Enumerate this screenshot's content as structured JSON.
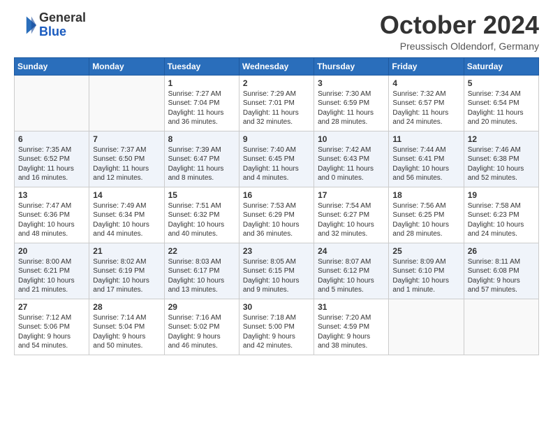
{
  "header": {
    "logo": {
      "line1": "General",
      "line2": "Blue"
    },
    "title": "October 2024",
    "subtitle": "Preussisch Oldendorf, Germany"
  },
  "days_of_week": [
    "Sunday",
    "Monday",
    "Tuesday",
    "Wednesday",
    "Thursday",
    "Friday",
    "Saturday"
  ],
  "weeks": [
    [
      {
        "day": "",
        "info": ""
      },
      {
        "day": "",
        "info": ""
      },
      {
        "day": "1",
        "info": "Sunrise: 7:27 AM\nSunset: 7:04 PM\nDaylight: 11 hours\nand 36 minutes."
      },
      {
        "day": "2",
        "info": "Sunrise: 7:29 AM\nSunset: 7:01 PM\nDaylight: 11 hours\nand 32 minutes."
      },
      {
        "day": "3",
        "info": "Sunrise: 7:30 AM\nSunset: 6:59 PM\nDaylight: 11 hours\nand 28 minutes."
      },
      {
        "day": "4",
        "info": "Sunrise: 7:32 AM\nSunset: 6:57 PM\nDaylight: 11 hours\nand 24 minutes."
      },
      {
        "day": "5",
        "info": "Sunrise: 7:34 AM\nSunset: 6:54 PM\nDaylight: 11 hours\nand 20 minutes."
      }
    ],
    [
      {
        "day": "6",
        "info": "Sunrise: 7:35 AM\nSunset: 6:52 PM\nDaylight: 11 hours\nand 16 minutes."
      },
      {
        "day": "7",
        "info": "Sunrise: 7:37 AM\nSunset: 6:50 PM\nDaylight: 11 hours\nand 12 minutes."
      },
      {
        "day": "8",
        "info": "Sunrise: 7:39 AM\nSunset: 6:47 PM\nDaylight: 11 hours\nand 8 minutes."
      },
      {
        "day": "9",
        "info": "Sunrise: 7:40 AM\nSunset: 6:45 PM\nDaylight: 11 hours\nand 4 minutes."
      },
      {
        "day": "10",
        "info": "Sunrise: 7:42 AM\nSunset: 6:43 PM\nDaylight: 11 hours\nand 0 minutes."
      },
      {
        "day": "11",
        "info": "Sunrise: 7:44 AM\nSunset: 6:41 PM\nDaylight: 10 hours\nand 56 minutes."
      },
      {
        "day": "12",
        "info": "Sunrise: 7:46 AM\nSunset: 6:38 PM\nDaylight: 10 hours\nand 52 minutes."
      }
    ],
    [
      {
        "day": "13",
        "info": "Sunrise: 7:47 AM\nSunset: 6:36 PM\nDaylight: 10 hours\nand 48 minutes."
      },
      {
        "day": "14",
        "info": "Sunrise: 7:49 AM\nSunset: 6:34 PM\nDaylight: 10 hours\nand 44 minutes."
      },
      {
        "day": "15",
        "info": "Sunrise: 7:51 AM\nSunset: 6:32 PM\nDaylight: 10 hours\nand 40 minutes."
      },
      {
        "day": "16",
        "info": "Sunrise: 7:53 AM\nSunset: 6:29 PM\nDaylight: 10 hours\nand 36 minutes."
      },
      {
        "day": "17",
        "info": "Sunrise: 7:54 AM\nSunset: 6:27 PM\nDaylight: 10 hours\nand 32 minutes."
      },
      {
        "day": "18",
        "info": "Sunrise: 7:56 AM\nSunset: 6:25 PM\nDaylight: 10 hours\nand 28 minutes."
      },
      {
        "day": "19",
        "info": "Sunrise: 7:58 AM\nSunset: 6:23 PM\nDaylight: 10 hours\nand 24 minutes."
      }
    ],
    [
      {
        "day": "20",
        "info": "Sunrise: 8:00 AM\nSunset: 6:21 PM\nDaylight: 10 hours\nand 21 minutes."
      },
      {
        "day": "21",
        "info": "Sunrise: 8:02 AM\nSunset: 6:19 PM\nDaylight: 10 hours\nand 17 minutes."
      },
      {
        "day": "22",
        "info": "Sunrise: 8:03 AM\nSunset: 6:17 PM\nDaylight: 10 hours\nand 13 minutes."
      },
      {
        "day": "23",
        "info": "Sunrise: 8:05 AM\nSunset: 6:15 PM\nDaylight: 10 hours\nand 9 minutes."
      },
      {
        "day": "24",
        "info": "Sunrise: 8:07 AM\nSunset: 6:12 PM\nDaylight: 10 hours\nand 5 minutes."
      },
      {
        "day": "25",
        "info": "Sunrise: 8:09 AM\nSunset: 6:10 PM\nDaylight: 10 hours\nand 1 minute."
      },
      {
        "day": "26",
        "info": "Sunrise: 8:11 AM\nSunset: 6:08 PM\nDaylight: 9 hours\nand 57 minutes."
      }
    ],
    [
      {
        "day": "27",
        "info": "Sunrise: 7:12 AM\nSunset: 5:06 PM\nDaylight: 9 hours\nand 54 minutes."
      },
      {
        "day": "28",
        "info": "Sunrise: 7:14 AM\nSunset: 5:04 PM\nDaylight: 9 hours\nand 50 minutes."
      },
      {
        "day": "29",
        "info": "Sunrise: 7:16 AM\nSunset: 5:02 PM\nDaylight: 9 hours\nand 46 minutes."
      },
      {
        "day": "30",
        "info": "Sunrise: 7:18 AM\nSunset: 5:00 PM\nDaylight: 9 hours\nand 42 minutes."
      },
      {
        "day": "31",
        "info": "Sunrise: 7:20 AM\nSunset: 4:59 PM\nDaylight: 9 hours\nand 38 minutes."
      },
      {
        "day": "",
        "info": ""
      },
      {
        "day": "",
        "info": ""
      }
    ]
  ]
}
